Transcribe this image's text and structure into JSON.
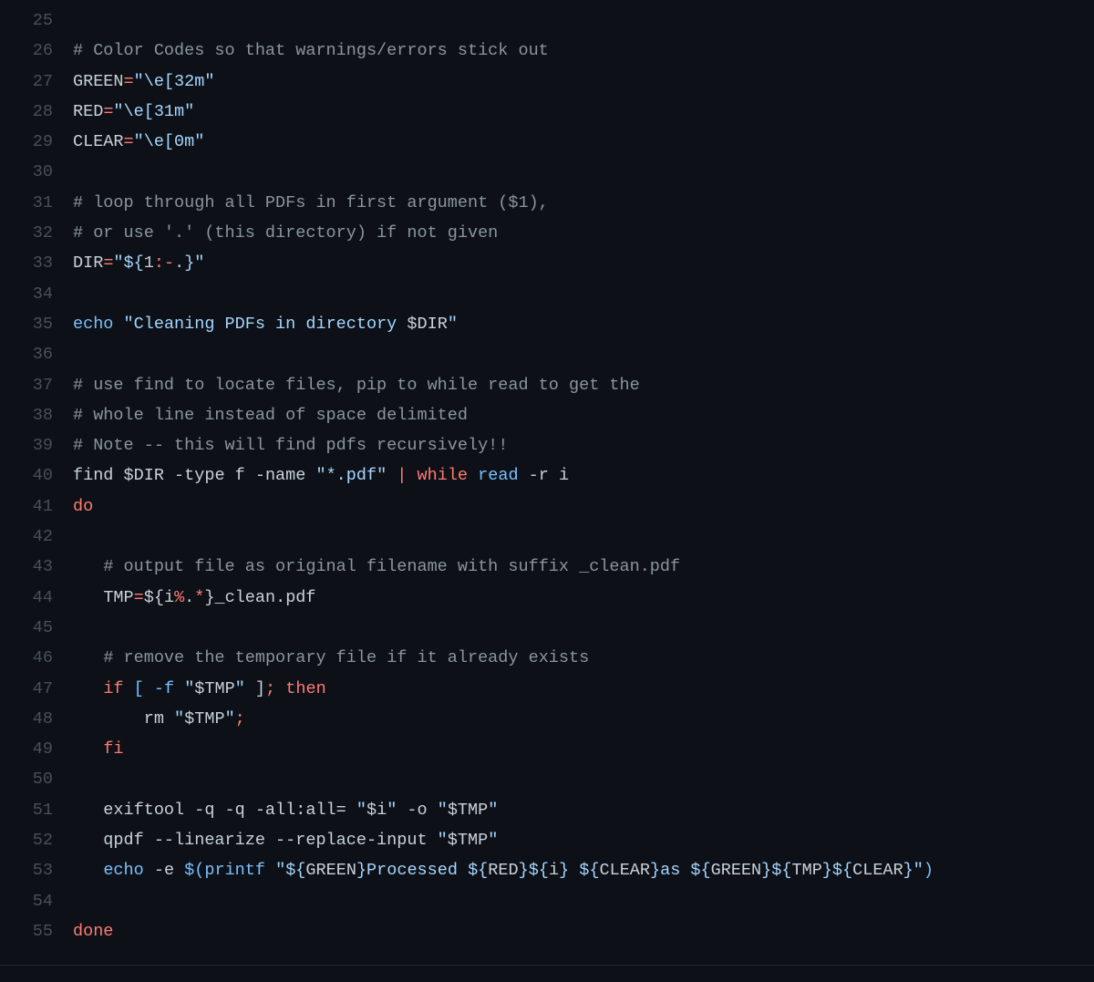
{
  "startLine": 25,
  "lines": [
    {
      "tokens": []
    },
    {
      "tokens": [
        {
          "cls": "tok-comment",
          "text": "# Color Codes so that warnings/errors stick out"
        }
      ]
    },
    {
      "tokens": [
        {
          "cls": "tok-var",
          "text": "GREEN"
        },
        {
          "cls": "tok-op",
          "text": "="
        },
        {
          "cls": "tok-string",
          "text": "\"\\e[32m\""
        }
      ]
    },
    {
      "tokens": [
        {
          "cls": "tok-var",
          "text": "RED"
        },
        {
          "cls": "tok-op",
          "text": "="
        },
        {
          "cls": "tok-string",
          "text": "\"\\e[31m\""
        }
      ]
    },
    {
      "tokens": [
        {
          "cls": "tok-var",
          "text": "CLEAR"
        },
        {
          "cls": "tok-op",
          "text": "="
        },
        {
          "cls": "tok-string",
          "text": "\"\\e[0m\""
        }
      ]
    },
    {
      "tokens": []
    },
    {
      "tokens": [
        {
          "cls": "tok-comment",
          "text": "# loop through all PDFs in first argument ($1),"
        }
      ]
    },
    {
      "tokens": [
        {
          "cls": "tok-comment",
          "text": "# or use '.' (this directory) if not given"
        }
      ]
    },
    {
      "tokens": [
        {
          "cls": "tok-var",
          "text": "DIR"
        },
        {
          "cls": "tok-op",
          "text": "="
        },
        {
          "cls": "tok-string",
          "text": "\""
        },
        {
          "cls": "tok-string",
          "text": "${"
        },
        {
          "cls": "tok-var",
          "text": "1"
        },
        {
          "cls": "tok-op",
          "text": ":-"
        },
        {
          "cls": "tok-string",
          "text": "."
        },
        {
          "cls": "tok-string",
          "text": "}"
        },
        {
          "cls": "tok-string",
          "text": "\""
        }
      ]
    },
    {
      "tokens": []
    },
    {
      "tokens": [
        {
          "cls": "tok-builtin",
          "text": "echo"
        },
        {
          "cls": "tok-plain",
          "text": " "
        },
        {
          "cls": "tok-string",
          "text": "\"Cleaning PDFs in directory "
        },
        {
          "cls": "tok-var",
          "text": "$DIR"
        },
        {
          "cls": "tok-string",
          "text": "\""
        }
      ]
    },
    {
      "tokens": []
    },
    {
      "tokens": [
        {
          "cls": "tok-comment",
          "text": "# use find to locate files, pip to while read to get the"
        }
      ]
    },
    {
      "tokens": [
        {
          "cls": "tok-comment",
          "text": "# whole line instead of space delimited"
        }
      ]
    },
    {
      "tokens": [
        {
          "cls": "tok-comment",
          "text": "# Note -- this will find pdfs recursively!!"
        }
      ]
    },
    {
      "tokens": [
        {
          "cls": "tok-plain",
          "text": "find "
        },
        {
          "cls": "tok-var",
          "text": "$DIR"
        },
        {
          "cls": "tok-plain",
          "text": " -type f -name "
        },
        {
          "cls": "tok-string",
          "text": "\"*.pdf\""
        },
        {
          "cls": "tok-plain",
          "text": " "
        },
        {
          "cls": "tok-op",
          "text": "|"
        },
        {
          "cls": "tok-plain",
          "text": " "
        },
        {
          "cls": "tok-keyword",
          "text": "while"
        },
        {
          "cls": "tok-plain",
          "text": " "
        },
        {
          "cls": "tok-builtin",
          "text": "read"
        },
        {
          "cls": "tok-plain",
          "text": " -r i"
        }
      ]
    },
    {
      "tokens": [
        {
          "cls": "tok-keyword",
          "text": "do"
        }
      ]
    },
    {
      "tokens": []
    },
    {
      "tokens": [
        {
          "cls": "tok-plain",
          "text": "   "
        },
        {
          "cls": "tok-comment",
          "text": "# output file as original filename with suffix _clean.pdf"
        }
      ]
    },
    {
      "tokens": [
        {
          "cls": "tok-plain",
          "text": "   "
        },
        {
          "cls": "tok-var",
          "text": "TMP"
        },
        {
          "cls": "tok-op",
          "text": "="
        },
        {
          "cls": "tok-plain",
          "text": "${"
        },
        {
          "cls": "tok-var",
          "text": "i"
        },
        {
          "cls": "tok-op",
          "text": "%"
        },
        {
          "cls": "tok-plain",
          "text": "."
        },
        {
          "cls": "tok-op",
          "text": "*"
        },
        {
          "cls": "tok-plain",
          "text": "}_clean.pdf"
        }
      ]
    },
    {
      "tokens": []
    },
    {
      "tokens": [
        {
          "cls": "tok-plain",
          "text": "   "
        },
        {
          "cls": "tok-comment",
          "text": "# remove the temporary file if it already exists"
        }
      ]
    },
    {
      "tokens": [
        {
          "cls": "tok-plain",
          "text": "   "
        },
        {
          "cls": "tok-keyword",
          "text": "if"
        },
        {
          "cls": "tok-plain",
          "text": " "
        },
        {
          "cls": "tok-builtin",
          "text": "["
        },
        {
          "cls": "tok-plain",
          "text": " "
        },
        {
          "cls": "tok-builtin",
          "text": "-f"
        },
        {
          "cls": "tok-plain",
          "text": " "
        },
        {
          "cls": "tok-string",
          "text": "\""
        },
        {
          "cls": "tok-var",
          "text": "$TMP"
        },
        {
          "cls": "tok-string",
          "text": "\""
        },
        {
          "cls": "tok-plain",
          "text": " ]"
        },
        {
          "cls": "tok-op",
          "text": ";"
        },
        {
          "cls": "tok-plain",
          "text": " "
        },
        {
          "cls": "tok-keyword",
          "text": "then"
        }
      ]
    },
    {
      "tokens": [
        {
          "cls": "tok-plain",
          "text": "       rm "
        },
        {
          "cls": "tok-string",
          "text": "\""
        },
        {
          "cls": "tok-var",
          "text": "$TMP"
        },
        {
          "cls": "tok-string",
          "text": "\""
        },
        {
          "cls": "tok-op",
          "text": ";"
        }
      ]
    },
    {
      "tokens": [
        {
          "cls": "tok-plain",
          "text": "   "
        },
        {
          "cls": "tok-keyword",
          "text": "fi"
        }
      ]
    },
    {
      "tokens": []
    },
    {
      "tokens": [
        {
          "cls": "tok-plain",
          "text": "   exiftool -q -q -all:all= "
        },
        {
          "cls": "tok-string",
          "text": "\""
        },
        {
          "cls": "tok-var",
          "text": "$i"
        },
        {
          "cls": "tok-string",
          "text": "\""
        },
        {
          "cls": "tok-plain",
          "text": " -o "
        },
        {
          "cls": "tok-string",
          "text": "\""
        },
        {
          "cls": "tok-var",
          "text": "$TMP"
        },
        {
          "cls": "tok-string",
          "text": "\""
        }
      ]
    },
    {
      "tokens": [
        {
          "cls": "tok-plain",
          "text": "   qpdf --linearize --replace-input "
        },
        {
          "cls": "tok-string",
          "text": "\""
        },
        {
          "cls": "tok-var",
          "text": "$TMP"
        },
        {
          "cls": "tok-string",
          "text": "\""
        }
      ]
    },
    {
      "tokens": [
        {
          "cls": "tok-plain",
          "text": "   "
        },
        {
          "cls": "tok-builtin",
          "text": "echo"
        },
        {
          "cls": "tok-plain",
          "text": " -e "
        },
        {
          "cls": "tok-builtin",
          "text": "$("
        },
        {
          "cls": "tok-builtin",
          "text": "printf "
        },
        {
          "cls": "tok-string",
          "text": "\""
        },
        {
          "cls": "tok-string",
          "text": "${"
        },
        {
          "cls": "tok-var",
          "text": "GREEN"
        },
        {
          "cls": "tok-string",
          "text": "}"
        },
        {
          "cls": "tok-string",
          "text": "Processed "
        },
        {
          "cls": "tok-string",
          "text": "${"
        },
        {
          "cls": "tok-var",
          "text": "RED"
        },
        {
          "cls": "tok-string",
          "text": "}"
        },
        {
          "cls": "tok-string",
          "text": "${"
        },
        {
          "cls": "tok-var",
          "text": "i"
        },
        {
          "cls": "tok-string",
          "text": "}"
        },
        {
          "cls": "tok-string",
          "text": " "
        },
        {
          "cls": "tok-string",
          "text": "${"
        },
        {
          "cls": "tok-var",
          "text": "CLEAR"
        },
        {
          "cls": "tok-string",
          "text": "}"
        },
        {
          "cls": "tok-string",
          "text": "as "
        },
        {
          "cls": "tok-string",
          "text": "${"
        },
        {
          "cls": "tok-var",
          "text": "GREEN"
        },
        {
          "cls": "tok-string",
          "text": "}"
        },
        {
          "cls": "tok-string",
          "text": "${"
        },
        {
          "cls": "tok-var",
          "text": "TMP"
        },
        {
          "cls": "tok-string",
          "text": "}"
        },
        {
          "cls": "tok-string",
          "text": "${"
        },
        {
          "cls": "tok-var",
          "text": "CLEAR"
        },
        {
          "cls": "tok-string",
          "text": "}"
        },
        {
          "cls": "tok-string",
          "text": "\""
        },
        {
          "cls": "tok-builtin",
          "text": ")"
        }
      ]
    },
    {
      "tokens": []
    },
    {
      "tokens": [
        {
          "cls": "tok-keyword",
          "text": "done"
        }
      ]
    }
  ]
}
